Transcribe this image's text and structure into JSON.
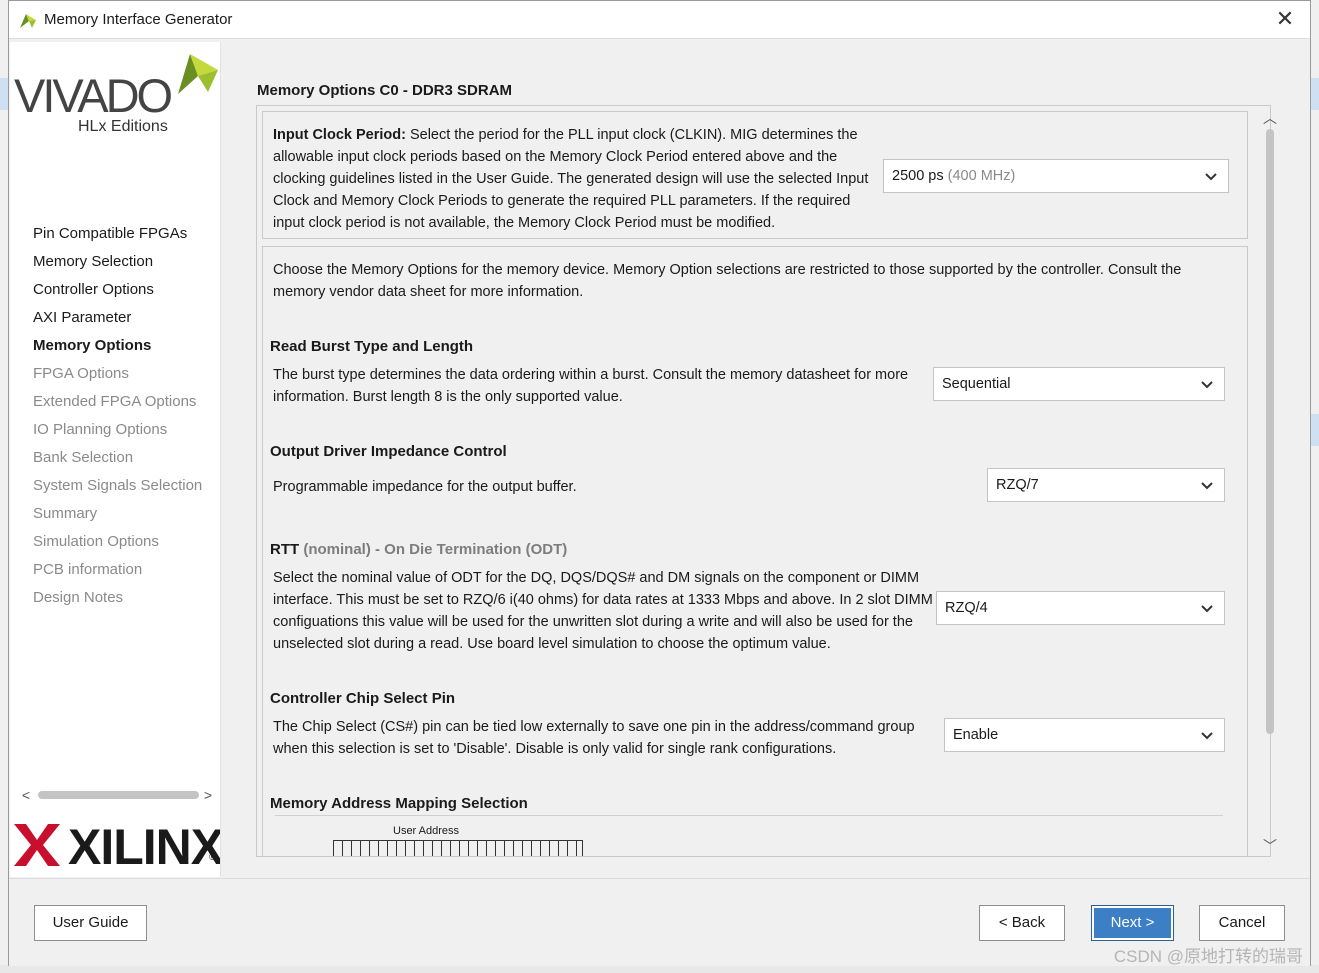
{
  "window": {
    "title": "Memory Interface Generator"
  },
  "branding": {
    "vivado_word": "VIVADO",
    "vivado_edition": "HLx Editions",
    "xilinx_word": "XILINX",
    "xilinx_reg": "®"
  },
  "nav": {
    "items": [
      {
        "label": "Pin Compatible FPGAs",
        "state": "normal"
      },
      {
        "label": "Memory Selection",
        "state": "normal"
      },
      {
        "label": "Controller Options",
        "state": "normal"
      },
      {
        "label": "AXI Parameter",
        "state": "normal"
      },
      {
        "label": "Memory Options",
        "state": "active"
      },
      {
        "label": "FPGA Options",
        "state": "disabled"
      },
      {
        "label": "Extended FPGA Options",
        "state": "disabled"
      },
      {
        "label": "IO Planning Options",
        "state": "disabled"
      },
      {
        "label": "Bank Selection",
        "state": "disabled"
      },
      {
        "label": "System Signals Selection",
        "state": "disabled"
      },
      {
        "label": "Summary",
        "state": "disabled"
      },
      {
        "label": "Simulation Options",
        "state": "disabled"
      },
      {
        "label": "PCB information",
        "state": "disabled"
      },
      {
        "label": "Design Notes",
        "state": "disabled"
      }
    ]
  },
  "main": {
    "title": "Memory Options C0 - DDR3 SDRAM",
    "input_clock": {
      "heading": "Input Clock Period:",
      "text": "Select the period for the PLL input clock (CLKIN). MIG determines the allowable input clock periods based on the Memory Clock Period entered above and the clocking guidelines listed in the User Guide. The generated design will use the selected Input Clock and Memory Clock Periods to generate the required PLL parameters. If the required input clock period is not available, the Memory Clock Period must be modified.",
      "value": "2500 ps",
      "value_hint": "(400 MHz)"
    },
    "intro": "Choose the Memory Options for the memory device. Memory Option selections are restricted to those supported by the controller. Consult the memory vendor data sheet for more information.",
    "read_burst": {
      "title": "Read Burst Type and Length",
      "text": "The burst type determines the data ordering within a burst. Consult the memory datasheet for more information. Burst length 8 is the only supported value.",
      "value": "Sequential"
    },
    "output_driver": {
      "title": "Output Driver Impedance Control",
      "text": "Programmable impedance for the output buffer.",
      "value": "RZQ/7"
    },
    "rtt": {
      "title_main": "RTT",
      "title_dim": "(nominal) - On Die Termination (ODT)",
      "text": "Select the nominal value of ODT for the DQ, DQS/DQS# and DM signals on the component or DIMM interface. This must be set to RZQ/6 i(40 ohms) for data rates at 1333 Mbps and above. In 2 slot DIMM configuations this value will be used for the unwritten slot during a write and will also be used for the unselected slot during a read. Use board level simulation to choose the optimum value.",
      "value": "RZQ/4"
    },
    "chip_select": {
      "title": "Controller Chip Select Pin",
      "text": "The Chip Select (CS#) pin can be tied low externally to save one pin in the address/command group when this selection is set to 'Disable'. Disable is only valid for single rank configurations.",
      "value": "Enable"
    },
    "address_mapping": {
      "title": "Memory Address Mapping Selection",
      "user_address_label": "User Address"
    }
  },
  "footer": {
    "user_guide": "User Guide",
    "back": "< Back",
    "next": "Next >",
    "cancel": "Cancel"
  },
  "watermark": "CSDN @原地打转的瑞哥",
  "colors": {
    "primary_button": "#3c7fc5",
    "disabled_text": "#8a8a8a",
    "panel_bg": "#f0f0f0",
    "xilinx_red": "#c8102e",
    "vivado_leaf": "#9bbf2e"
  }
}
